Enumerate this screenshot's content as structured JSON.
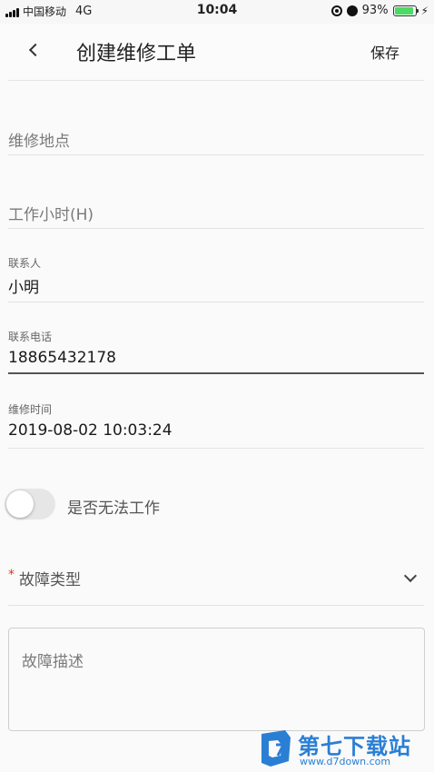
{
  "status_bar": {
    "carrier": "中国移动",
    "network": "4G",
    "time": "10:04",
    "battery_percent": "93%",
    "battery_level": 0.93
  },
  "nav": {
    "title": "创建维修工单",
    "save_label": "保存"
  },
  "form": {
    "location_placeholder": "维修地点",
    "hours_placeholder": "工作小时(H)",
    "contact": {
      "label": "联系人",
      "value": "小明"
    },
    "phone": {
      "label": "联系电话",
      "value": "18865432178"
    },
    "repair_time": {
      "label": "维修时间",
      "value": "2019-08-02 10:03:24"
    },
    "unable_to_work": {
      "label": "是否无法工作",
      "checked": false
    },
    "fault_type": {
      "required_mark": "*",
      "label": "故障类型"
    },
    "fault_description_placeholder": "故障描述"
  },
  "watermark": {
    "brand": "第七下载站",
    "url": "www.d7down.com"
  },
  "colors": {
    "accent": "#2a7fd4",
    "required": "#d9381e",
    "battery": "#4cd964"
  }
}
